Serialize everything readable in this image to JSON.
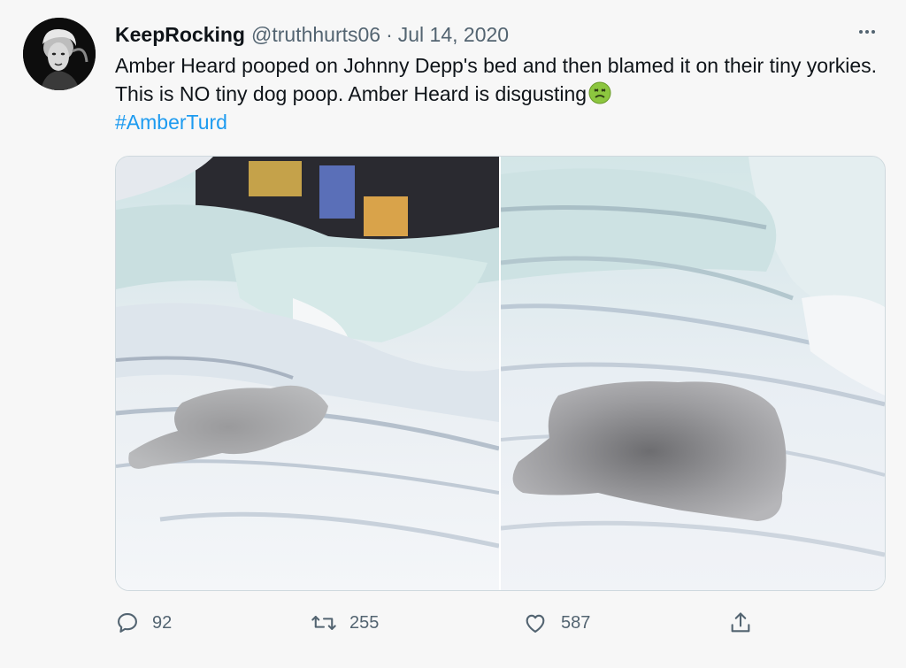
{
  "tweet": {
    "display_name": "KeepRocking",
    "handle": "@truthhurts06",
    "separator": "·",
    "date": "Jul 14, 2020",
    "text_part1": "Amber Heard pooped on Johnny Depp's bed and then blamed it on their tiny yorkies. This is NO tiny dog poop. Amber Heard is disgusting",
    "emoji": "nauseated-face-emoji",
    "hashtag": "#AmberTurd"
  },
  "media": {
    "count": 2,
    "items": [
      {
        "description": "white bed sheets with blurred stain"
      },
      {
        "description": "white bed sheets with blurred stain"
      }
    ]
  },
  "actions": {
    "reply_count": "92",
    "retweet_count": "255",
    "like_count": "587",
    "icons": [
      "reply-icon",
      "retweet-icon",
      "like-icon",
      "share-icon"
    ]
  },
  "colors": {
    "text": "#0f1419",
    "secondary": "#536471",
    "link": "#1d9bf0"
  }
}
